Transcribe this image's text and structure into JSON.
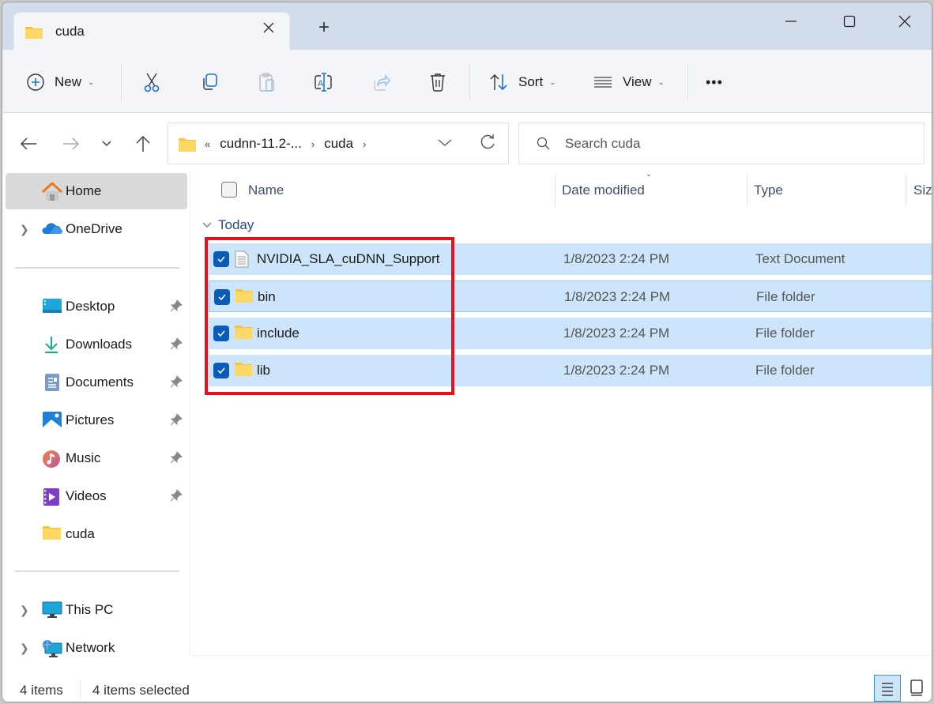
{
  "window": {
    "tab_title": "cuda",
    "new_tab_label": "+",
    "controls": {
      "minimize": "minimize",
      "maximize": "maximize",
      "close": "close"
    }
  },
  "toolbar": {
    "new_label": "New",
    "sort_label": "Sort",
    "view_label": "View",
    "more_label": "•••",
    "icons": [
      "plus-circle-icon",
      "cut-icon",
      "copy-icon",
      "paste-icon",
      "rename-icon",
      "share-icon",
      "delete-icon",
      "sort-icon",
      "view-icon",
      "more-icon"
    ]
  },
  "address": {
    "overflow_marker": "«",
    "crumbs": [
      "cudnn-11.2-...",
      "cuda"
    ],
    "search_placeholder": "Search cuda"
  },
  "sidebar": {
    "top_items": [
      {
        "label": "Home",
        "icon": "home-icon",
        "active": true
      },
      {
        "label": "OneDrive",
        "icon": "onedrive-icon",
        "expandable": true
      }
    ],
    "quick_access": [
      {
        "label": "Desktop",
        "icon": "desktop-icon",
        "pinned": true
      },
      {
        "label": "Downloads",
        "icon": "downloads-icon",
        "pinned": true
      },
      {
        "label": "Documents",
        "icon": "documents-icon",
        "pinned": true
      },
      {
        "label": "Pictures",
        "icon": "pictures-icon",
        "pinned": true
      },
      {
        "label": "Music",
        "icon": "music-icon",
        "pinned": true
      },
      {
        "label": "Videos",
        "icon": "videos-icon",
        "pinned": true
      },
      {
        "label": "cuda",
        "icon": "folder-icon",
        "pinned": false
      }
    ],
    "bottom_items": [
      {
        "label": "This PC",
        "icon": "this-pc-icon",
        "expandable": true
      },
      {
        "label": "Network",
        "icon": "network-icon",
        "expandable": true
      }
    ]
  },
  "filelist": {
    "columns": [
      "Name",
      "Date modified",
      "Type",
      "Size"
    ],
    "sorted_column": "Date modified",
    "group_label": "Today",
    "rows": [
      {
        "name": "NVIDIA_SLA_cuDNN_Support",
        "date": "1/8/2023 2:24 PM",
        "type": "Text Document",
        "icon": "text-file-icon",
        "selected": true
      },
      {
        "name": "bin",
        "date": "1/8/2023 2:24 PM",
        "type": "File folder",
        "icon": "folder-icon",
        "selected": true
      },
      {
        "name": "include",
        "date": "1/8/2023 2:24 PM",
        "type": "File folder",
        "icon": "folder-icon",
        "selected": true
      },
      {
        "name": "lib",
        "date": "1/8/2023 2:24 PM",
        "type": "File folder",
        "icon": "folder-icon",
        "selected": true
      }
    ]
  },
  "status": {
    "item_count": "4 items",
    "selected_count": "4 items selected"
  },
  "colors": {
    "accent": "#0a5cb8",
    "selection": "#cce5fb",
    "highlight_box": "#e3131e",
    "titlebar": "#d3dceb"
  }
}
